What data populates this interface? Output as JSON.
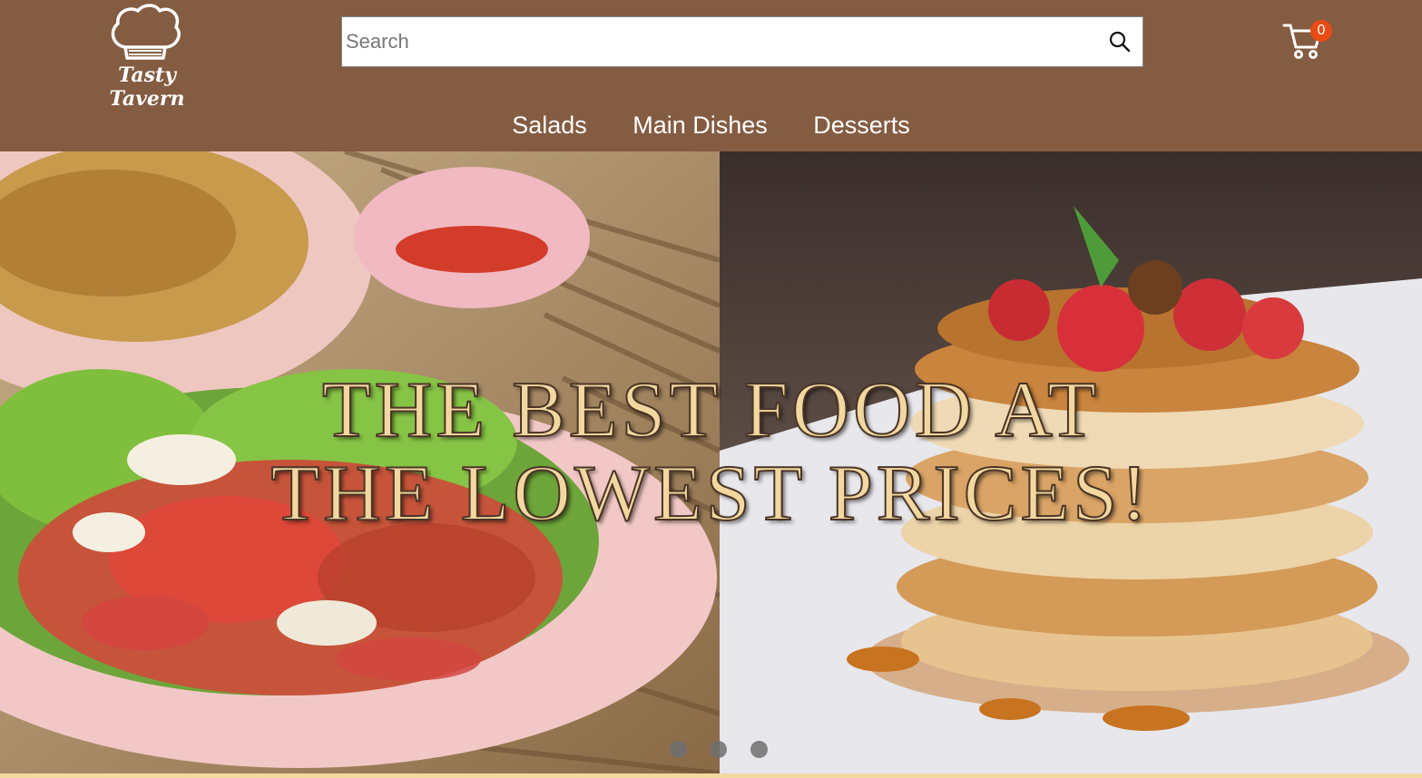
{
  "header": {
    "logo_text": "Tasty Tavern",
    "logo_icon": "chef-hat-icon",
    "background_color": "#845c41"
  },
  "search": {
    "placeholder": "Search",
    "value": "",
    "button_icon": "search-icon"
  },
  "cart": {
    "icon": "cart-icon",
    "count": "0",
    "badge_color": "#ea4b14"
  },
  "nav": {
    "items": [
      {
        "label": "Salads"
      },
      {
        "label": "Main Dishes"
      },
      {
        "label": "Desserts"
      }
    ]
  },
  "hero": {
    "title_line1": "THE BEST FOOD AT",
    "title_line2": "THE LOWEST PRICES!",
    "title_color": "#f2d8a0",
    "slides": [
      "salad-photo",
      "pancakes-photo"
    ],
    "carousel_dots": 3
  }
}
